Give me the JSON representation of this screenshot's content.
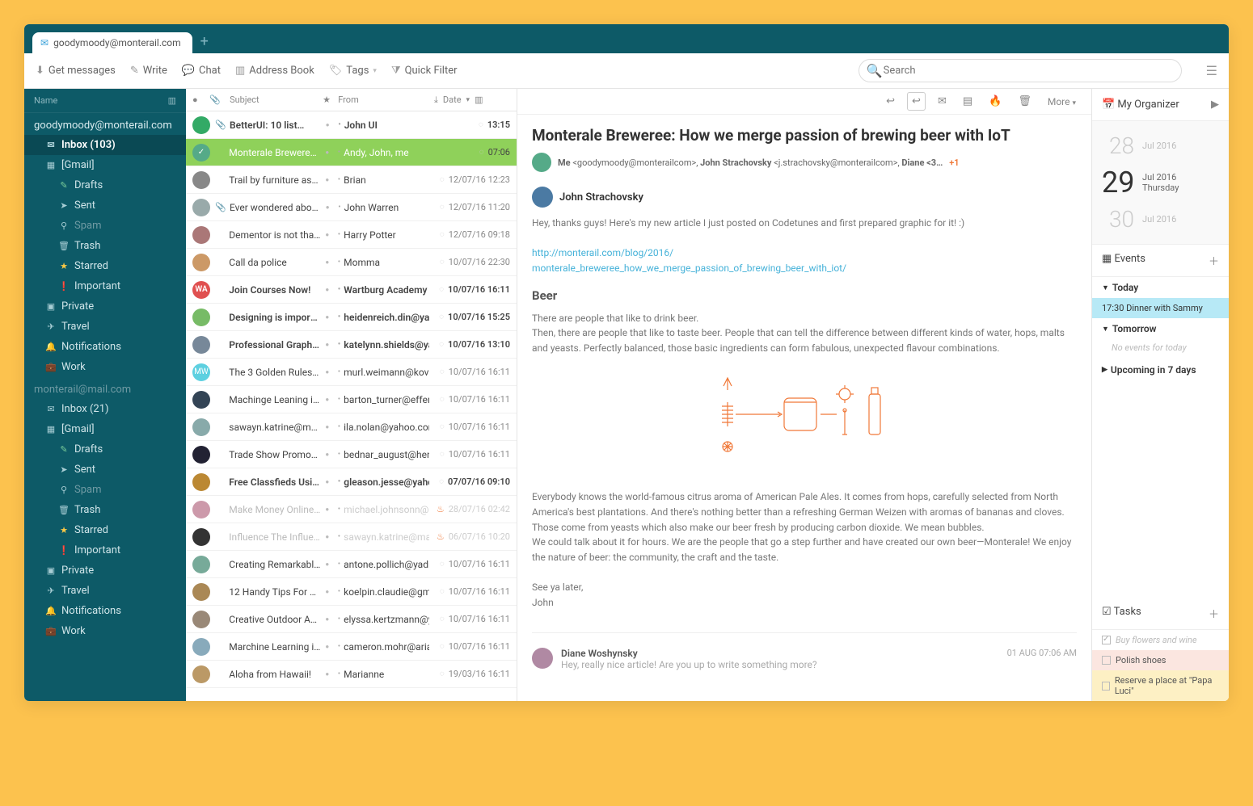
{
  "tab": {
    "email": "goodymoody@monterail.com"
  },
  "toolbar": {
    "get_messages": "Get messages",
    "write": "Write",
    "chat": "Chat",
    "address_book": "Address Book",
    "tags": "Tags",
    "quick_filter": "Quick Filter",
    "search_placeholder": "Search"
  },
  "sidebar": {
    "head": "Name",
    "accounts": [
      {
        "email": "goodymoody@monterail.com",
        "folders": [
          {
            "icon": "✉",
            "label": "Inbox (103)",
            "cls": "sel"
          },
          {
            "icon": "▦",
            "label": "[Gmail]"
          },
          {
            "icon": "✎",
            "label": "Drafts",
            "cls": "sub drafts"
          },
          {
            "icon": "➤",
            "label": "Sent",
            "cls": "sub"
          },
          {
            "icon": "⚲",
            "label": "Spam",
            "cls": "sub dim"
          },
          {
            "icon": "🗑",
            "label": "Trash",
            "cls": "sub"
          },
          {
            "icon": "★",
            "label": "Starred",
            "cls": "sub starred"
          },
          {
            "icon": "❗",
            "label": "Important",
            "cls": "sub important"
          },
          {
            "icon": "▣",
            "label": "Private"
          },
          {
            "icon": "✈",
            "label": "Travel"
          },
          {
            "icon": "🔔",
            "label": "Notifications"
          },
          {
            "icon": "💼",
            "label": "Work"
          }
        ]
      },
      {
        "email": "monterail@mail.com",
        "dim": true,
        "folders": [
          {
            "icon": "✉",
            "label": "Inbox  (21)"
          },
          {
            "icon": "▦",
            "label": "[Gmail]"
          },
          {
            "icon": "✎",
            "label": "Drafts",
            "cls": "sub drafts"
          },
          {
            "icon": "➤",
            "label": "Sent",
            "cls": "sub"
          },
          {
            "icon": "⚲",
            "label": "Spam",
            "cls": "sub dim"
          },
          {
            "icon": "🗑",
            "label": "Trash",
            "cls": "sub"
          },
          {
            "icon": "★",
            "label": "Starred",
            "cls": "sub starred"
          },
          {
            "icon": "❗",
            "label": "Important",
            "cls": "sub important"
          },
          {
            "icon": "▣",
            "label": "Private"
          },
          {
            "icon": "✈",
            "label": "Travel"
          },
          {
            "icon": "🔔",
            "label": "Notifications"
          },
          {
            "icon": "💼",
            "label": "Work"
          }
        ]
      }
    ]
  },
  "msghead": {
    "subject": "Subject",
    "from": "From",
    "date": "Date"
  },
  "messages": [
    {
      "av": "#3a6",
      "att": true,
      "subj": "BetterUI: 10 list…",
      "from": "John UI",
      "date": "13:15",
      "unread": true
    },
    {
      "av": "#5a8",
      "subj": "Monterale Breweree: H…",
      "from": "Andy, John, me",
      "date": "07:06",
      "sel": true,
      "green": true
    },
    {
      "av": "#888",
      "subj": "Trail by furniture as…",
      "from": "Brian",
      "date": "12/07/16 12:23"
    },
    {
      "av": "#9aa",
      "att": true,
      "subj": "Ever wondered abou…",
      "from": "John Warren",
      "date": "12/07/16 11:20"
    },
    {
      "av": "#a77",
      "subj": "Dementor is not that bad",
      "from": "Harry Potter",
      "date": "12/07/16 09:18"
    },
    {
      "av": "#c96",
      "subj": "Call da police",
      "from": "Momma",
      "date": "10/07/16 22:30"
    },
    {
      "av": "#e05050",
      "txt": "WA",
      "subj": "Join Courses Now!",
      "from": "Wartburg Academy",
      "date": "10/07/16 16:11",
      "unread": true
    },
    {
      "av": "#7b6",
      "subj": "Designing is important",
      "from": "heidenreich.din@yaho…",
      "date": "10/07/16 15:25",
      "unread": true
    },
    {
      "av": "#789",
      "subj": "Professional Graphic De…",
      "from": "katelynn.shields@yahoo…",
      "date": "10/07/16 13:10",
      "unread": true
    },
    {
      "av": "#5dd0e0",
      "txt": "MW",
      "subj": "The 3 Golden Rules Proff…",
      "from": "murl.weimann@kovacek…",
      "date": "10/07/16 16:11"
    },
    {
      "av": "#345",
      "subj": "Machinge Leaning is …",
      "from": "barton_turner@effertz.co…",
      "date": "10/07/16 16:11"
    },
    {
      "av": "#8aa",
      "subj": "sawayn.katrine@manley…",
      "from": "ila.nolan@yahoo.com",
      "date": "10/07/16 16:11"
    },
    {
      "av": "#223",
      "subj": "Trade Show Promotions",
      "from": "bednar_august@henderso…",
      "date": "10/07/16 16:11"
    },
    {
      "av": "#b83",
      "subj": "Free Classfieds Using Th…",
      "from": "gleason.jesse@yahoo.com",
      "date": "07/07/16 09:10",
      "unread": true
    },
    {
      "av": "#c9a",
      "subj": "Make Money Online Thr…",
      "from": "michael.johnsonn@abc.c…",
      "date": "28/07/16 02:42",
      "dim": true,
      "hot": true
    },
    {
      "av": "#333",
      "subj": "Influence The Influence…",
      "from": "sawayn.katrine@manley…",
      "date": "06/07/16 10:20",
      "dim": true,
      "hot": true
    },
    {
      "av": "#7a9",
      "subj": "Creating Remarkable Po…",
      "from": "antone.pollich@yadira.io",
      "date": "10/07/16 16:11"
    },
    {
      "av": "#a85",
      "subj": "12 Handy Tips For Gener…",
      "from": "koelpin.claudie@gmail…",
      "date": "10/07/16 16:11"
    },
    {
      "av": "#987",
      "subj": "Creative Outdoor Ads",
      "from": "elyssa.kertzmann@yahoo…",
      "date": "10/07/16 16:11"
    },
    {
      "av": "#8ab",
      "subj": "Marchine Learning is …",
      "from": "cameron.mohr@ariane.na…",
      "date": "10/07/16 16:11"
    },
    {
      "av": "#b96",
      "subj": "Aloha from Hawaii!",
      "from": "Marianne",
      "date": "19/03/16 16:11"
    }
  ],
  "reader": {
    "more": "More",
    "title": "Monterale Breweree: How we merge passion of brewing beer with IoT",
    "meta_me": "Me",
    "meta_me_addr": "<goodymoody@monterailcom>",
    "meta_p2": "John Strachovsky",
    "meta_p2_addr": "<j.strachovsky@monterailcom>",
    "meta_p3": "Diane <3…",
    "meta_plus": "+1",
    "sender": "John Strachovsky",
    "p1": "Hey, thanks guys! Here's my new article I just posted on Codetunes and first prepared graphic for it! :)",
    "link1": "http://monterail.com/blog/2016/",
    "link2": "monterale_breweree_how_we_merge_passion_of_brewing_beer_with_iot/",
    "h_beer": "Beer",
    "p2": "There are people that like to drink beer.",
    "p3": "Then, there are people that like to taste beer. People that can tell the difference between different kinds of water, hops, malts and yeasts. Perfectly balanced, those basic ingredients can form fabulous, unexpected flavour combinations.",
    "p4": "Everybody knows the world-famous citrus aroma of American Pale Ales. It comes from hops, carefully selected from North America's best plantations. And there's nothing better than a refreshing German Weizen with aromas of bananas and cloves. Those come from yeasts which also make our beer fresh by producing carbon dioxide. We mean bubbles.",
    "p5": "We could talk about it for hours. We are the people that go a step further and have created our own beer—Monterale! We enjoy the nature of beer: the community, the craft and the taste.",
    "p6": "See ya later,",
    "p7": "John",
    "reply_name": "Diane Woshynsky",
    "reply_ts": "01 AUG 07:06 AM",
    "reply_txt": "Hey, really nice article! Are you up to write something more?"
  },
  "organizer": {
    "title": "My Organizer",
    "days": [
      {
        "num": "28",
        "txt": "Jul 2016"
      },
      {
        "num": "29",
        "txt": "Jul 2016",
        "day": "Thursday",
        "today": true
      },
      {
        "num": "30",
        "txt": "Jul 2016"
      }
    ],
    "events_title": "Events",
    "today": "Today",
    "evt1": "17:30 Dinner with Sammy",
    "tomorrow": "Tomorrow",
    "noevt": "No events for today",
    "upcoming": "Upcoming in 7 days",
    "tasks_title": "Tasks",
    "tasks": [
      {
        "label": "Buy flowers and wine",
        "done": true
      },
      {
        "label": "Polish shoes",
        "cls": "pink"
      },
      {
        "label": "Reserve a place at  \"Papa Luci\"",
        "cls": "yellow"
      }
    ]
  }
}
